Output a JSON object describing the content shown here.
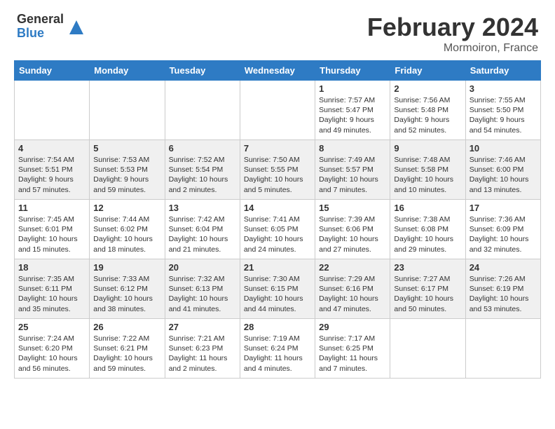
{
  "header": {
    "logo_general": "General",
    "logo_blue": "Blue",
    "title": "February 2024",
    "location": "Mormoiron, France"
  },
  "days_of_week": [
    "Sunday",
    "Monday",
    "Tuesday",
    "Wednesday",
    "Thursday",
    "Friday",
    "Saturday"
  ],
  "weeks": [
    [
      {
        "day": "",
        "info": ""
      },
      {
        "day": "",
        "info": ""
      },
      {
        "day": "",
        "info": ""
      },
      {
        "day": "",
        "info": ""
      },
      {
        "day": "1",
        "info": "Sunrise: 7:57 AM\nSunset: 5:47 PM\nDaylight: 9 hours\nand 49 minutes."
      },
      {
        "day": "2",
        "info": "Sunrise: 7:56 AM\nSunset: 5:48 PM\nDaylight: 9 hours\nand 52 minutes."
      },
      {
        "day": "3",
        "info": "Sunrise: 7:55 AM\nSunset: 5:50 PM\nDaylight: 9 hours\nand 54 minutes."
      }
    ],
    [
      {
        "day": "4",
        "info": "Sunrise: 7:54 AM\nSunset: 5:51 PM\nDaylight: 9 hours\nand 57 minutes."
      },
      {
        "day": "5",
        "info": "Sunrise: 7:53 AM\nSunset: 5:53 PM\nDaylight: 9 hours\nand 59 minutes."
      },
      {
        "day": "6",
        "info": "Sunrise: 7:52 AM\nSunset: 5:54 PM\nDaylight: 10 hours\nand 2 minutes."
      },
      {
        "day": "7",
        "info": "Sunrise: 7:50 AM\nSunset: 5:55 PM\nDaylight: 10 hours\nand 5 minutes."
      },
      {
        "day": "8",
        "info": "Sunrise: 7:49 AM\nSunset: 5:57 PM\nDaylight: 10 hours\nand 7 minutes."
      },
      {
        "day": "9",
        "info": "Sunrise: 7:48 AM\nSunset: 5:58 PM\nDaylight: 10 hours\nand 10 minutes."
      },
      {
        "day": "10",
        "info": "Sunrise: 7:46 AM\nSunset: 6:00 PM\nDaylight: 10 hours\nand 13 minutes."
      }
    ],
    [
      {
        "day": "11",
        "info": "Sunrise: 7:45 AM\nSunset: 6:01 PM\nDaylight: 10 hours\nand 15 minutes."
      },
      {
        "day": "12",
        "info": "Sunrise: 7:44 AM\nSunset: 6:02 PM\nDaylight: 10 hours\nand 18 minutes."
      },
      {
        "day": "13",
        "info": "Sunrise: 7:42 AM\nSunset: 6:04 PM\nDaylight: 10 hours\nand 21 minutes."
      },
      {
        "day": "14",
        "info": "Sunrise: 7:41 AM\nSunset: 6:05 PM\nDaylight: 10 hours\nand 24 minutes."
      },
      {
        "day": "15",
        "info": "Sunrise: 7:39 AM\nSunset: 6:06 PM\nDaylight: 10 hours\nand 27 minutes."
      },
      {
        "day": "16",
        "info": "Sunrise: 7:38 AM\nSunset: 6:08 PM\nDaylight: 10 hours\nand 29 minutes."
      },
      {
        "day": "17",
        "info": "Sunrise: 7:36 AM\nSunset: 6:09 PM\nDaylight: 10 hours\nand 32 minutes."
      }
    ],
    [
      {
        "day": "18",
        "info": "Sunrise: 7:35 AM\nSunset: 6:11 PM\nDaylight: 10 hours\nand 35 minutes."
      },
      {
        "day": "19",
        "info": "Sunrise: 7:33 AM\nSunset: 6:12 PM\nDaylight: 10 hours\nand 38 minutes."
      },
      {
        "day": "20",
        "info": "Sunrise: 7:32 AM\nSunset: 6:13 PM\nDaylight: 10 hours\nand 41 minutes."
      },
      {
        "day": "21",
        "info": "Sunrise: 7:30 AM\nSunset: 6:15 PM\nDaylight: 10 hours\nand 44 minutes."
      },
      {
        "day": "22",
        "info": "Sunrise: 7:29 AM\nSunset: 6:16 PM\nDaylight: 10 hours\nand 47 minutes."
      },
      {
        "day": "23",
        "info": "Sunrise: 7:27 AM\nSunset: 6:17 PM\nDaylight: 10 hours\nand 50 minutes."
      },
      {
        "day": "24",
        "info": "Sunrise: 7:26 AM\nSunset: 6:19 PM\nDaylight: 10 hours\nand 53 minutes."
      }
    ],
    [
      {
        "day": "25",
        "info": "Sunrise: 7:24 AM\nSunset: 6:20 PM\nDaylight: 10 hours\nand 56 minutes."
      },
      {
        "day": "26",
        "info": "Sunrise: 7:22 AM\nSunset: 6:21 PM\nDaylight: 10 hours\nand 59 minutes."
      },
      {
        "day": "27",
        "info": "Sunrise: 7:21 AM\nSunset: 6:23 PM\nDaylight: 11 hours\nand 2 minutes."
      },
      {
        "day": "28",
        "info": "Sunrise: 7:19 AM\nSunset: 6:24 PM\nDaylight: 11 hours\nand 4 minutes."
      },
      {
        "day": "29",
        "info": "Sunrise: 7:17 AM\nSunset: 6:25 PM\nDaylight: 11 hours\nand 7 minutes."
      },
      {
        "day": "",
        "info": ""
      },
      {
        "day": "",
        "info": ""
      }
    ]
  ]
}
